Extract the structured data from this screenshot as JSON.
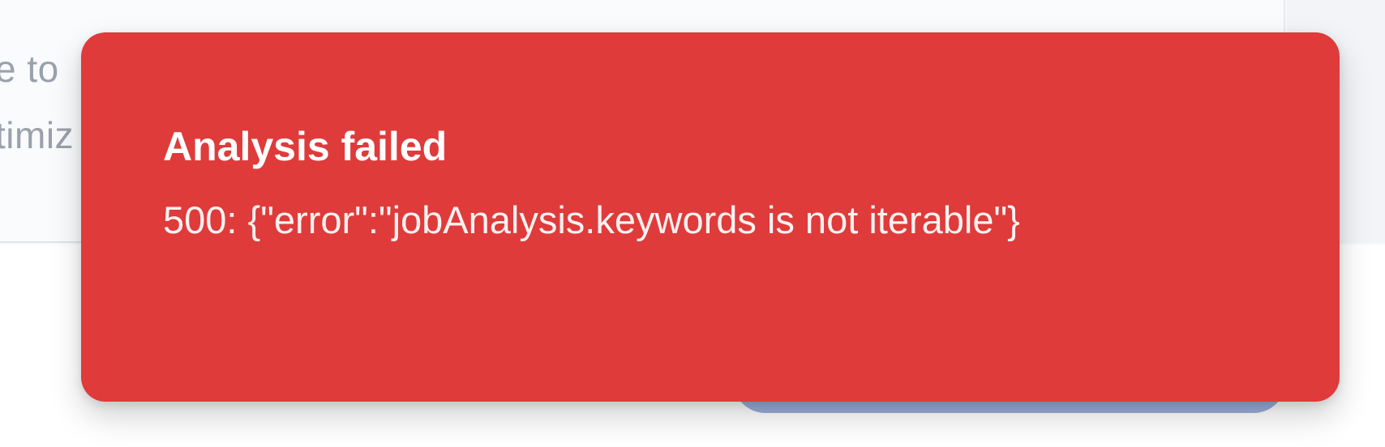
{
  "background": {
    "text_line_1": "e to",
    "text_line_2": "timiz"
  },
  "toast": {
    "title": "Analysis failed",
    "description": "500: {\"error\":\"jobAnalysis.keywords is not iterable\"}",
    "variant": "destructive",
    "background_color": "#df3b3b"
  },
  "colors": {
    "button_bg": "#9badda",
    "muted_text": "#9aa1ab"
  }
}
